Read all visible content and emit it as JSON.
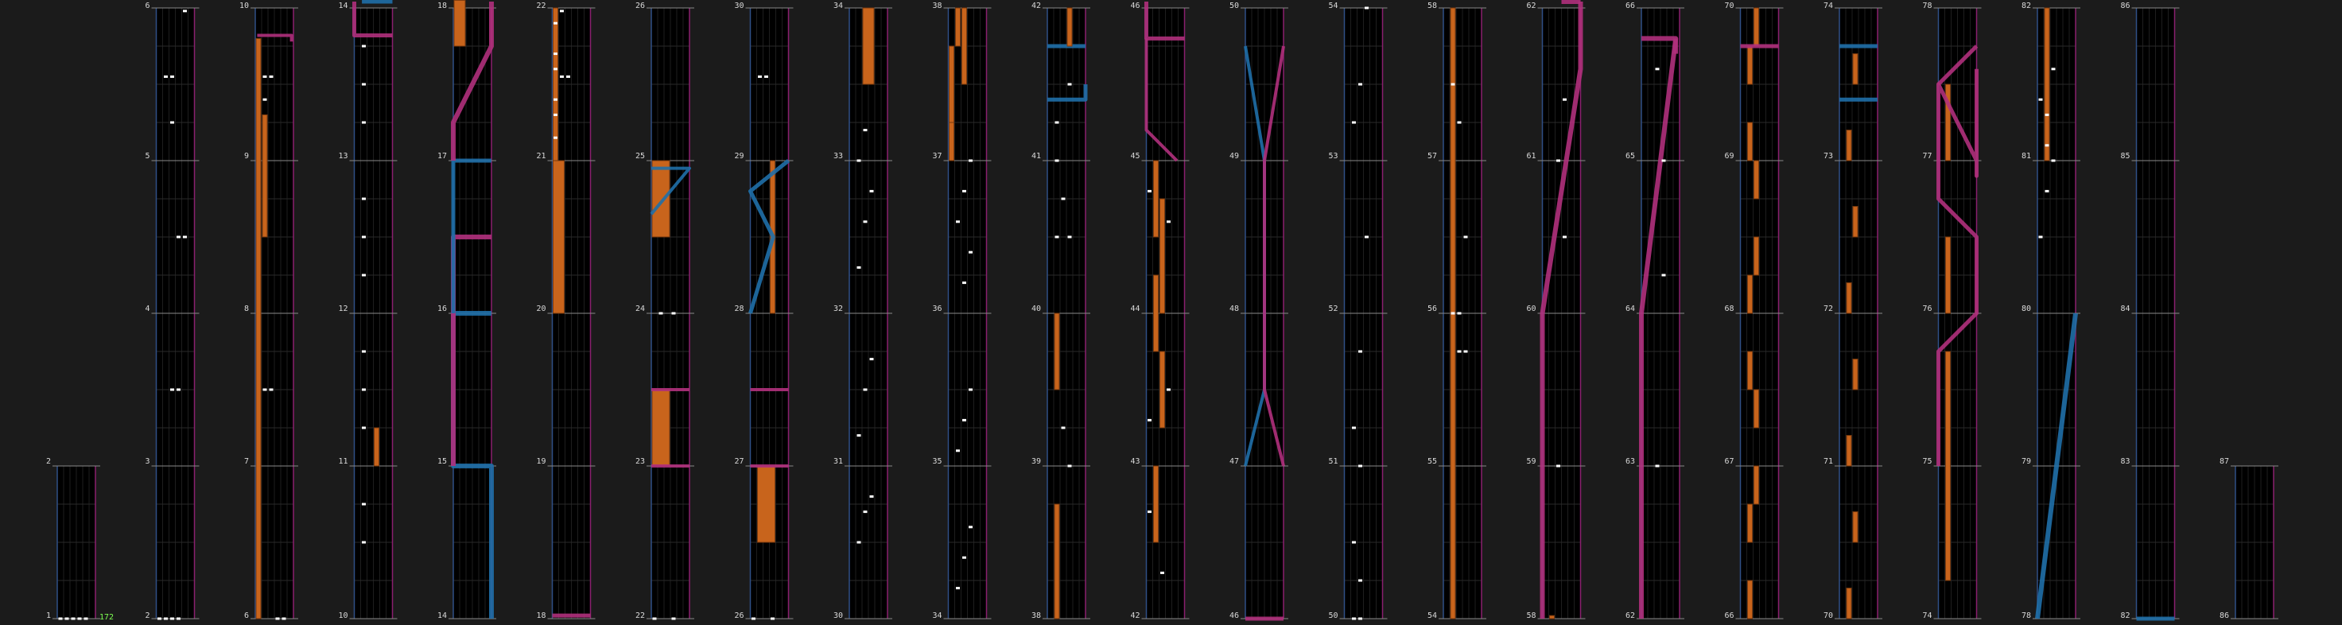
{
  "chart_view": {
    "combo": "172",
    "colors": {
      "background": "#1b1b1b",
      "lane_bg": "#000000",
      "hold_orange": "#c8641c",
      "slide_pink": "#b0307c",
      "slide_blue": "#1f6fa8",
      "note_white": "#ffffff",
      "combo_green": "#7dff52",
      "measure_label": "#d9d9d9",
      "left_border": "#2f4f86",
      "right_border": "#8a1f6e"
    },
    "columns": [
      {
        "start": 1,
        "end": 2
      },
      {
        "start": 2,
        "end": 6
      },
      {
        "start": 6,
        "end": 10
      },
      {
        "start": 10,
        "end": 14
      },
      {
        "start": 14,
        "end": 18
      },
      {
        "start": 18,
        "end": 22
      },
      {
        "start": 22,
        "end": 26
      },
      {
        "start": 26,
        "end": 30
      },
      {
        "start": 30,
        "end": 34
      },
      {
        "start": 34,
        "end": 38
      },
      {
        "start": 38,
        "end": 42
      },
      {
        "start": 42,
        "end": 46
      },
      {
        "start": 46,
        "end": 50
      },
      {
        "start": 50,
        "end": 54
      },
      {
        "start": 54,
        "end": 58
      },
      {
        "start": 58,
        "end": 62
      },
      {
        "start": 62,
        "end": 66
      },
      {
        "start": 66,
        "end": 70
      },
      {
        "start": 70,
        "end": 74
      },
      {
        "start": 74,
        "end": 78
      },
      {
        "start": 78,
        "end": 82
      },
      {
        "start": 82,
        "end": 86
      },
      {
        "start": 86,
        "end": 87
      }
    ],
    "labels": [
      [
        "1",
        "2"
      ],
      [
        "2",
        "3",
        "4",
        "5",
        "6"
      ],
      [
        "6",
        "7",
        "8",
        "9",
        "10"
      ],
      [
        "10",
        "11",
        "12",
        "13",
        "14"
      ],
      [
        "14",
        "15",
        "16",
        "17",
        "18"
      ],
      [
        "18",
        "19",
        "20",
        "21",
        "22"
      ],
      [
        "22",
        "23",
        "24",
        "25",
        "26"
      ],
      [
        "26",
        "27",
        "28",
        "29",
        "30"
      ],
      [
        "30",
        "31",
        "32",
        "33",
        "34"
      ],
      [
        "34",
        "35",
        "36",
        "37",
        "38"
      ],
      [
        "38",
        "39",
        "40",
        "41",
        "42"
      ],
      [
        "42",
        "43",
        "44",
        "45",
        "46"
      ],
      [
        "46",
        "47",
        "48",
        "49",
        "50"
      ],
      [
        "50",
        "51",
        "52",
        "53",
        "54"
      ],
      [
        "54",
        "55",
        "56",
        "57",
        "58"
      ],
      [
        "58",
        "59",
        "60",
        "61",
        "62"
      ],
      [
        "62",
        "63",
        "64",
        "65",
        "66"
      ],
      [
        "66",
        "67",
        "68",
        "69",
        "70"
      ],
      [
        "70",
        "71",
        "72",
        "73",
        "74"
      ],
      [
        "74",
        "75",
        "76",
        "77",
        "78"
      ],
      [
        "78",
        "79",
        "80",
        "81",
        "82"
      ],
      [
        "82",
        "83",
        "84",
        "85",
        "86"
      ],
      [
        "86",
        "87"
      ]
    ]
  }
}
